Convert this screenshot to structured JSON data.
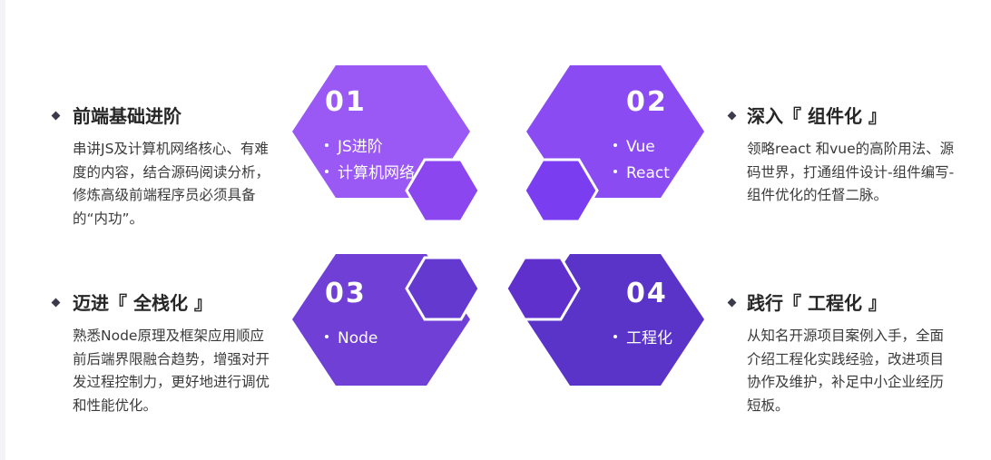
{
  "colors": {
    "hex_1": "#9a58f5",
    "hex_1_small": "#8b46f0",
    "hex_2": "#8a4cf2",
    "hex_2_small": "#7b3df0",
    "hex_3": "#6f3fd6",
    "hex_3_small": "#6339cf",
    "hex_4": "#5a33c8",
    "hex_4_small": "#5f30cc",
    "hex_border": "#ffffff"
  },
  "hexagons": [
    {
      "number": "01",
      "items": [
        "JS进阶",
        "计算机网络"
      ]
    },
    {
      "number": "02",
      "items": [
        "Vue",
        "React"
      ]
    },
    {
      "number": "03",
      "items": [
        "Node"
      ]
    },
    {
      "number": "04",
      "items": [
        "工程化"
      ]
    }
  ],
  "features": [
    {
      "title": "前端基础进阶",
      "desc": "串讲JS及计算机网络核心、有难度的内容，结合源码阅读分析，修炼高级前端程序员必须具备的“内功”。"
    },
    {
      "title": "深入『 组件化 』",
      "desc": "领略react 和vue的高阶用法、源码世界，打通组件设计-组件编写-组件优化的任督二脉。"
    },
    {
      "title": "迈进『 全栈化 』",
      "desc": "熟悉Node原理及框架应用顺应前后端界限融合趋势，增强对开发过程控制力，更好地进行调优和性能优化。"
    },
    {
      "title": "践行『 工程化 』",
      "desc": "从知名开源项目案例入手，全面介绍工程化实践经验，改进项目协作及维护，补足中小企业经历短板。"
    }
  ]
}
